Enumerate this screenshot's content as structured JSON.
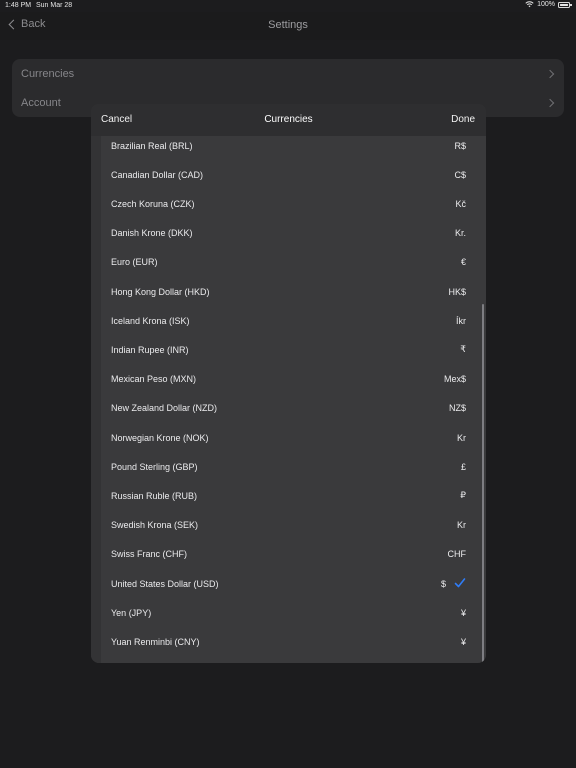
{
  "status_bar": {
    "time": "1:48 PM",
    "date": "Sun Mar 28",
    "battery": "100%"
  },
  "nav": {
    "back_label": "Back",
    "title": "Settings"
  },
  "settings": {
    "items": [
      {
        "label": "Currencies"
      },
      {
        "label": "Account"
      }
    ]
  },
  "modal": {
    "cancel_label": "Cancel",
    "title": "Currencies",
    "done_label": "Done",
    "currencies": [
      {
        "name": "Brazilian Real (BRL)",
        "symbol": "R$"
      },
      {
        "name": "Canadian Dollar (CAD)",
        "symbol": "C$"
      },
      {
        "name": "Czech Koruna (CZK)",
        "symbol": "Kč"
      },
      {
        "name": "Danish Krone (DKK)",
        "symbol": "Kr."
      },
      {
        "name": "Euro (EUR)",
        "symbol": "€"
      },
      {
        "name": "Hong Kong Dollar (HKD)",
        "symbol": "HK$"
      },
      {
        "name": "Iceland Krona (ISK)",
        "symbol": "Íkr"
      },
      {
        "name": "Indian Rupee (INR)",
        "symbol": "₹"
      },
      {
        "name": "Mexican Peso (MXN)",
        "symbol": "Mex$"
      },
      {
        "name": "New Zealand Dollar (NZD)",
        "symbol": "NZ$"
      },
      {
        "name": "Norwegian Krone (NOK)",
        "symbol": "Kr"
      },
      {
        "name": "Pound Sterling (GBP)",
        "symbol": "£"
      },
      {
        "name": "Russian Ruble (RUB)",
        "symbol": "₽"
      },
      {
        "name": "Swedish Krona (SEK)",
        "symbol": "Kr"
      },
      {
        "name": "Swiss Franc (CHF)",
        "symbol": "CHF"
      },
      {
        "name": "United States Dollar (USD)",
        "symbol": "$",
        "selected": true
      },
      {
        "name": "Yen (JPY)",
        "symbol": "¥"
      },
      {
        "name": "Yuan Renminbi (CNY)",
        "symbol": "¥"
      }
    ]
  },
  "colors": {
    "accent": "#2f7cf6",
    "background": "#1c1c1e",
    "modal": "#3a3a3c"
  },
  "icons": {
    "wifi": "wifi-icon",
    "battery": "battery-icon",
    "back": "chevron-left-icon",
    "row": "chevron-right-icon",
    "selected": "checkmark-icon"
  }
}
